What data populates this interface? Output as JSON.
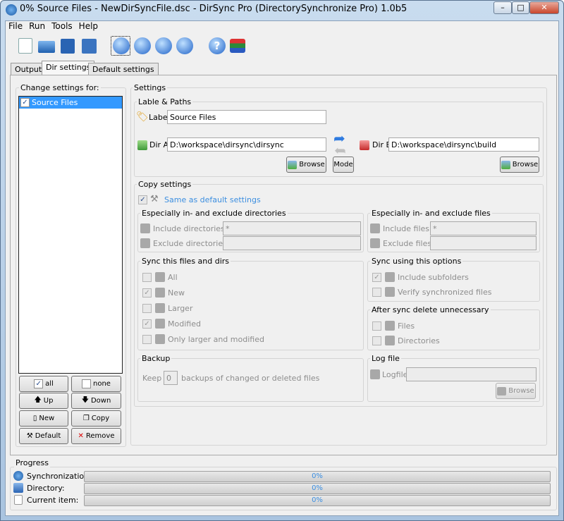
{
  "window": {
    "title": "0% Source Files - NewDirSyncFile.dsc - DirSync Pro (DirectorySynchronize Pro) 1.0b5"
  },
  "menu": [
    "File",
    "Run",
    "Tools",
    "Help"
  ],
  "tabs": [
    "Output",
    "Dir settings",
    "Default settings"
  ],
  "left": {
    "title": "Change settings for:",
    "items": [
      {
        "label": "Source Files",
        "checked": true
      }
    ],
    "buttons": {
      "all": "all",
      "none": "none",
      "up": "Up",
      "down": "Down",
      "new": "New",
      "copy": "Copy",
      "default": "Default",
      "remove": "Remove"
    }
  },
  "settings": {
    "title": "Settings",
    "paths": {
      "title": "Lable & Paths",
      "label_caption": "Label",
      "label_value": "Source Files",
      "dir_a_caption": "Dir A",
      "dir_a": "D:\\workspace\\dirsync\\dirsync",
      "dir_b_caption": "Dir B",
      "dir_b": "D:\\workspace\\dirsync\\build",
      "browse": "Browse",
      "mode": "Mode"
    },
    "copy": {
      "title": "Copy settings",
      "same_default": "Same as default settings",
      "dirs": {
        "title": "Especially in- and exclude directories",
        "include": "Include directories:",
        "include_value": "*",
        "exclude": "Exclude directories:",
        "exclude_value": ""
      },
      "files": {
        "title": "Especially in- and exclude files",
        "include": "Include files:",
        "include_value": "*",
        "exclude": "Exclude files:",
        "exclude_value": ""
      },
      "sync": {
        "title": "Sync this files and dirs",
        "items": [
          {
            "label": "All",
            "checked": false
          },
          {
            "label": "New",
            "checked": true
          },
          {
            "label": "Larger",
            "checked": false
          },
          {
            "label": "Modified",
            "checked": true
          },
          {
            "label": "Only larger and modified",
            "checked": false
          }
        ]
      },
      "options": {
        "title": "Sync using this options",
        "items": [
          {
            "label": "Include subfolders",
            "checked": true
          },
          {
            "label": "Verify synchronized files",
            "checked": false
          }
        ]
      },
      "delete": {
        "title": "After sync delete unnecessary",
        "items": [
          {
            "label": "Files",
            "checked": false
          },
          {
            "label": "Directories",
            "checked": false
          }
        ]
      },
      "backup": {
        "title": "Backup",
        "keep": "Keep",
        "count": "0",
        "suffix": "backups of changed or deleted files"
      },
      "log": {
        "title": "Log file",
        "caption": "Logfile",
        "value": "",
        "browse": "Browse"
      }
    }
  },
  "progress": {
    "title": "Progress",
    "rows": [
      {
        "label": "Synchronization:",
        "value": "0%"
      },
      {
        "label": "Directory:",
        "value": "0%"
      },
      {
        "label": "Current item:",
        "value": "0%"
      }
    ]
  }
}
